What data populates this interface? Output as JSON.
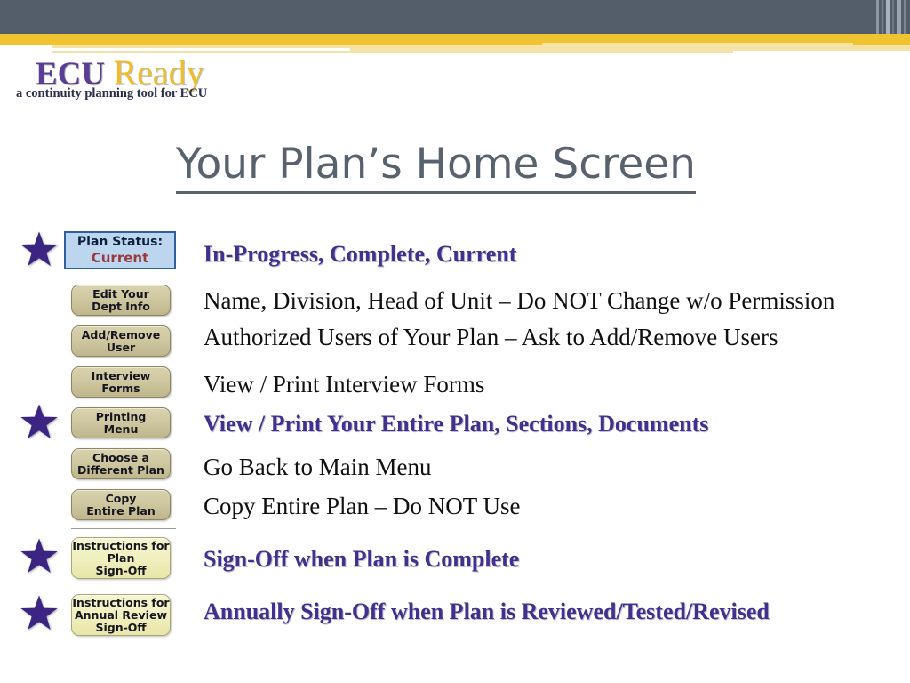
{
  "header": {
    "bar_dark_color": "#545e6a",
    "bar_gold_color": "#f0c330",
    "bar_cream_color": "#f5e2a6"
  },
  "logo": {
    "word_primary": "ECU",
    "word_secondary": "Ready",
    "tagline": "a continuity planning tool for ECU",
    "primary_color": "#5c3d96",
    "secondary_color": "#f0bc2c"
  },
  "title": "Your Plan’s Home Screen",
  "status_box": {
    "label": "Plan Status:",
    "value": "Current",
    "fill_color": "#bcd6f0",
    "border_color": "#2f5f9e",
    "value_color": "#9b3a3a"
  },
  "buttons": [
    {
      "id": "edit-dept-info",
      "label": "Edit Your\nDept Info",
      "style": "tan"
    },
    {
      "id": "add-remove-user",
      "label": "Add/Remove\nUser",
      "style": "tan"
    },
    {
      "id": "interview-forms",
      "label": "Interview\nForms",
      "style": "tan"
    },
    {
      "id": "printing-menu",
      "label": "Printing\nMenu",
      "style": "tan"
    },
    {
      "id": "choose-plan",
      "label": "Choose a\nDifferent Plan",
      "style": "tan"
    },
    {
      "id": "copy-entire-plan",
      "label": "Copy\nEntire Plan",
      "style": "tan"
    },
    {
      "id": "plan-sign-off",
      "label": "Instructions for\nPlan\nSign-Off",
      "style": "cream"
    },
    {
      "id": "annual-sign-off",
      "label": "Instructions for\nAnnual Review\nSign-Off",
      "style": "cream"
    }
  ],
  "descriptions": [
    {
      "id": "desc-status",
      "text": "In-Progress, Complete, Current",
      "emphasis": "highlight"
    },
    {
      "id": "desc-dept-info",
      "text": "Name, Division, Head of Unit – Do NOT Change w/o Permission",
      "emphasis": "plain"
    },
    {
      "id": "desc-users",
      "text": "Authorized Users of Your Plan – Ask to Add/Remove Users",
      "emphasis": "plain"
    },
    {
      "id": "desc-interview-forms",
      "text": "View / Print Interview Forms",
      "emphasis": "plain"
    },
    {
      "id": "desc-printing",
      "text": "View / Print Your Entire Plan, Sections, Documents",
      "emphasis": "highlight"
    },
    {
      "id": "desc-choose-plan",
      "text": "Go Back to Main Menu",
      "emphasis": "plain"
    },
    {
      "id": "desc-copy-plan",
      "text": "Copy Entire Plan – Do NOT Use",
      "emphasis": "plain"
    },
    {
      "id": "desc-plan-signoff",
      "text": "Sign-Off when Plan is Complete",
      "emphasis": "highlight"
    },
    {
      "id": "desc-annual-signoff",
      "text": "Annually Sign-Off when Plan is Reviewed/Tested/Revised",
      "emphasis": "highlight"
    }
  ],
  "stars": {
    "count": 4,
    "color": "#3b2482",
    "marks": [
      "plan-status",
      "printing-menu",
      "plan-sign-off",
      "annual-sign-off"
    ]
  }
}
